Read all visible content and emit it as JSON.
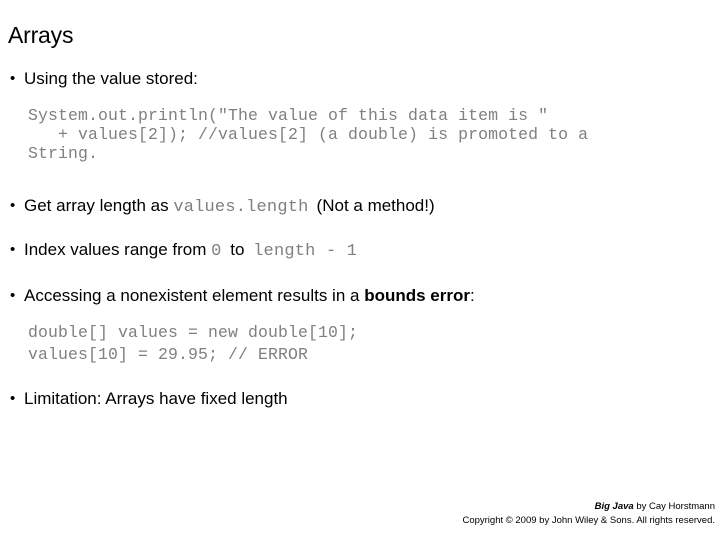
{
  "slide": {
    "title": "Arrays",
    "bullet_glyph": "•",
    "code_color": "#808080",
    "text_color": "#000000",
    "background": "#ffffff"
  },
  "bullets": {
    "using_value": "Using the value stored:",
    "get_length_pre": "Get array length as ",
    "get_length_code": "values.length",
    "get_length_post": "(Not a method!)",
    "index_pre": "Index values range from ",
    "index_code_zero": "0",
    "index_mid": " to ",
    "index_code_len": "length - 1",
    "accessing_pre": "Accessing a nonexistent element results in a ",
    "accessing_bold": "bounds error",
    "accessing_post": ":",
    "limitation": "Limitation: Arrays have fixed length"
  },
  "code_block_1": {
    "line1": "System.out.println(\"The value of this data item is \"",
    "line2": "   + values[2]); //values[2] (a double) is promoted to a",
    "line3": "String."
  },
  "code_block_2": {
    "line1": "double[] values = new double[10];",
    "line2": "values[10] = 29.95; // ERROR"
  },
  "footer": {
    "book_title": "Big Java",
    "author_line": " by Cay Horstmann",
    "copyright": "Copyright © 2009 by John Wiley & Sons.  All rights reserved."
  }
}
